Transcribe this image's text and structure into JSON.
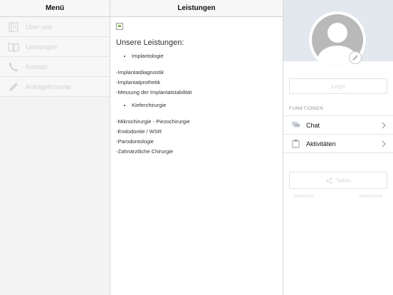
{
  "menu": {
    "title": "Menü",
    "items": [
      {
        "label": "Über uns",
        "icon": "book-icon"
      },
      {
        "label": "Leistungen",
        "icon": "open-book-icon"
      },
      {
        "label": "Kontakt",
        "icon": "phone-icon"
      },
      {
        "label": "Anfrageformular",
        "icon": "pencil-icon"
      }
    ]
  },
  "content": {
    "header": "Leistungen",
    "title": "Unsere Leistungen:",
    "bullet1": "Implantologie",
    "lines1": [
      "-Implantatdiagnostik",
      "-Implantatprothetik",
      "-Messung der Implantatstabilität"
    ],
    "bullet2": "Kieferchirurgie",
    "lines2": [
      "-Mikrochirurgie - Piezochirurgie",
      "-Endodontie / WSR",
      "-Parodontologie",
      "-Zahnärztliche Chirurgie"
    ]
  },
  "profile": {
    "login_label": "Login",
    "section_label": "FUNKTIONEN",
    "functions": [
      {
        "label": "Chat",
        "icon": "chat-icon"
      },
      {
        "label": "Aktivitäten",
        "icon": "clipboard-icon"
      }
    ],
    "share_label": "Teilen",
    "footer_left": "Impressum",
    "footer_right": "Datenschutz"
  },
  "colors": {
    "profile_bg": "#e3e8ef",
    "menu_bg": "#f3f3f3",
    "disabled_text": "#d2d2d2"
  }
}
